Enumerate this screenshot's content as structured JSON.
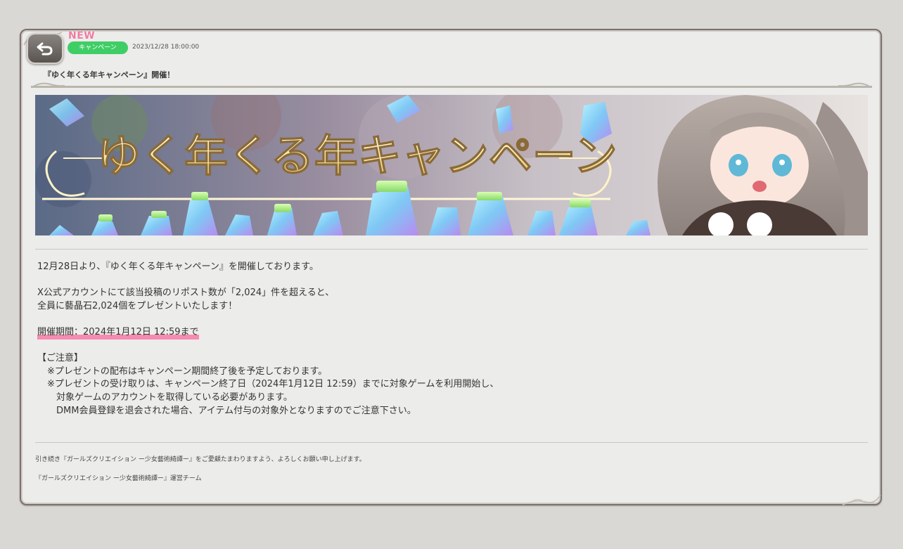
{
  "header": {
    "new_label": "NEW",
    "category": "キャンペーン",
    "date": "2023/12/28 18:00:00",
    "title": "『ゆく年くる年キャンペーン』開催！"
  },
  "banner": {
    "title_text": "ゆく年くる年キャンペーン"
  },
  "body": {
    "line1": "12月28日より、『ゆく年くる年キャンペーン』を開催しております。",
    "line2": "X公式アカウントにて該当投稿のリポスト数が「2,024」件を超えると、",
    "line3": "全員に藝晶石2,024個をプレゼントいたします！",
    "period": "開催期間：2024年1月12日 12:59まで",
    "notice_heading": "【ご注意】",
    "notice1": "※プレゼントの配布はキャンペーン期間終了後を予定しております。",
    "notice2": "※プレゼントの受け取りは、キャンペーン終了日（2024年1月12日 12:59）までに対象ゲームを利用開始し、",
    "notice3": "対象ゲームのアカウントを取得している必要があります。",
    "notice4": "DMM会員登録を退会された場合、アイテム付与の対象外となりますのでご注意下さい。"
  },
  "footer": {
    "line1": "引き続き『ガールズクリエイション ー少女藝術綺譚ー』をご愛顧たまわりますよう、よろしくお願い申し上げます。",
    "line2": "『ガールズクリエイション ー少女藝術綺譚ー』運営チーム"
  },
  "colors": {
    "background": "#d9d8d4",
    "panel": "#ececea",
    "category_badge": "#3fce66",
    "new_badge": "#f07aa0",
    "highlight": "#f58bb0"
  },
  "icons": {
    "back": "back-arrow-icon"
  }
}
